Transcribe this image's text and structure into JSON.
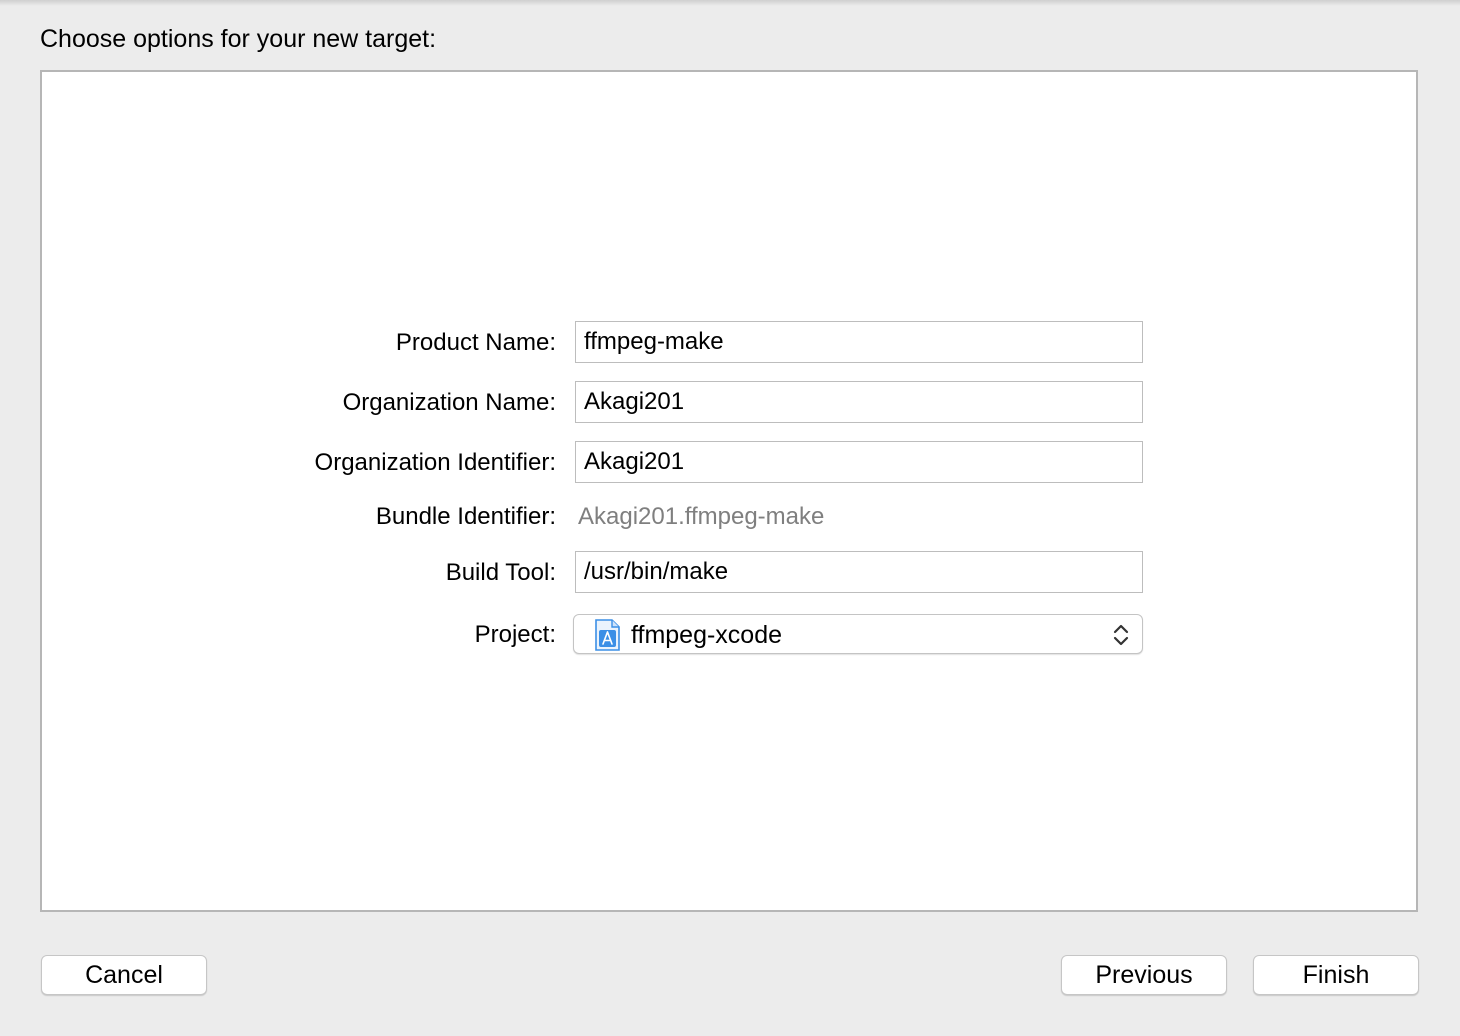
{
  "dialog": {
    "heading": "Choose options for your new target:"
  },
  "form": {
    "product_name": {
      "label": "Product Name:",
      "value": "ffmpeg-make"
    },
    "organization_name": {
      "label": "Organization Name:",
      "value": "Akagi201"
    },
    "organization_identifier": {
      "label": "Organization Identifier:",
      "value": "Akagi201"
    },
    "bundle_identifier": {
      "label": "Bundle Identifier:",
      "value": "Akagi201.ffmpeg-make"
    },
    "build_tool": {
      "label": "Build Tool:",
      "value": "/usr/bin/make"
    },
    "project": {
      "label": "Project:",
      "selected": "ffmpeg-xcode",
      "icon": "xcode-project-icon"
    }
  },
  "buttons": {
    "cancel": "Cancel",
    "previous": "Previous",
    "finish": "Finish"
  },
  "colors": {
    "window_background": "#ececec",
    "panel_background": "#ffffff",
    "secondary_text": "#7f7f7f",
    "icon_blue": "#3b8fe6"
  }
}
